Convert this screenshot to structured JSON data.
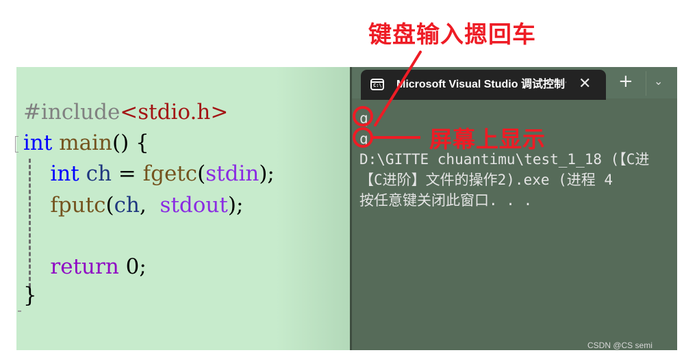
{
  "editor": {
    "lines": {
      "l1": {
        "hash_include": "#include",
        "header": "<stdio.h>"
      },
      "l2": {
        "kw_int": "int",
        "main": " main",
        "parens": "() {"
      },
      "l3": {
        "indent": "    ",
        "kw_int": "int",
        "ch": " ch",
        "eq": " = ",
        "fgetc": "fgetc",
        "lp": "(",
        "stdin": "stdin",
        "rp": ");"
      },
      "l4": {
        "indent": "    ",
        "fputc": "fputc",
        "lp": "(",
        "ch": "ch",
        "comma": ", ",
        "stdout": " stdout",
        "rp": ");"
      },
      "l5": {
        "indent": "    ",
        "kw_return": "return",
        "zero": " 0;"
      },
      "l6": {
        "brace": "}"
      }
    }
  },
  "terminal": {
    "tab_icon_label": "C:\\",
    "tab_title": "Microsoft Visual Studio 调试控制台",
    "close_glyph": "✕",
    "new_tab_glyph": "+",
    "dropdown_glyph": "⌄",
    "output": [
      "q",
      "q",
      "D:\\GITTE chuantimu\\test_1_18 (【C进",
      "【C进阶】文件的操作2).exe (进程 4",
      "按任意键关闭此窗口. . ."
    ]
  },
  "annotations": {
    "top_label": "键盘输入摁回车",
    "side_label": "屏幕上显示",
    "color": "#ee1c25"
  },
  "watermark": "CSDN @CS semi"
}
